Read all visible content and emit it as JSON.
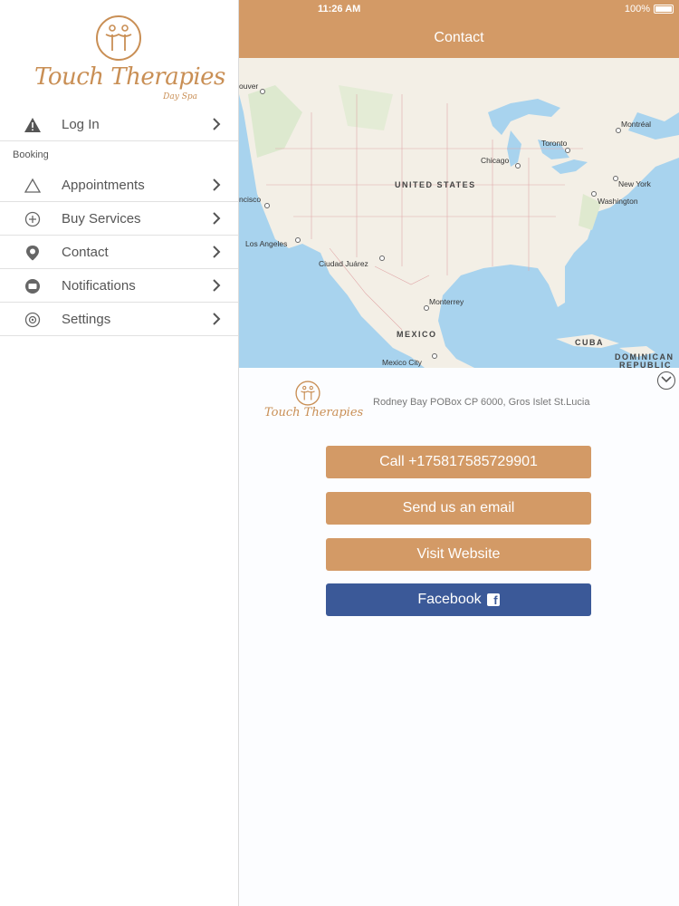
{
  "brand": {
    "name": "Touch Therapies",
    "tagline": "Day Spa",
    "accent": "#d39a66"
  },
  "sidebar": {
    "login": {
      "label": "Log In",
      "icon": "warning-icon"
    },
    "section_label": "Booking",
    "items": [
      {
        "label": "Appointments",
        "icon": "triangle-icon"
      },
      {
        "label": "Buy Services",
        "icon": "plus-circle-icon"
      },
      {
        "label": "Contact",
        "icon": "location-pin-icon"
      },
      {
        "label": "Notifications",
        "icon": "chat-bubble-icon"
      },
      {
        "label": "Settings",
        "icon": "gear-icon"
      }
    ]
  },
  "status_bar": {
    "time": "11:26 AM",
    "battery": "100%"
  },
  "navbar": {
    "title": "Contact"
  },
  "map": {
    "labels": {
      "vancouver": "ouver",
      "montreal": "Montréal",
      "toronto": "Toronto",
      "chicago": "Chicago",
      "united_states": "UNITED STATES",
      "new_york": "New York",
      "washington": "Washington",
      "san_francisco": "ncisco",
      "los_angeles": "Los Angeles",
      "ciudad_juarez": "Ciudad Juárez",
      "monterrey": "Monterrey",
      "mexico": "MEXICO",
      "mexico_city": "Mexico City",
      "cuba": "CUBA",
      "dominican": "DOMINICAN",
      "republic": "REPUBLIC"
    }
  },
  "contact": {
    "address": "Rodney Bay POBox CP 6000, Gros Islet St.Lucia",
    "call_label": "Call +175817585729901",
    "email_label": "Send us an email",
    "website_label": "Visit Website",
    "facebook_label": "Facebook",
    "facebook_color": "#3b5998"
  }
}
